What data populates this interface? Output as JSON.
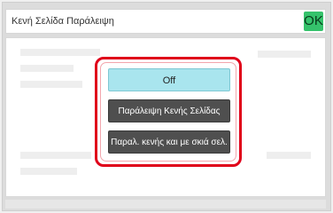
{
  "header": {
    "title": "Κενή Σελίδα Παράλειψη",
    "ok_label": "OK"
  },
  "dialog": {
    "options": [
      {
        "label": "Off",
        "selected": true
      },
      {
        "label": "Παράλειψη Κενής Σελίδας",
        "selected": false
      },
      {
        "label": "Παραλ. κενής και με σκιά σελ.",
        "selected": false
      }
    ]
  },
  "colors": {
    "ok_button": "#35c26b",
    "highlight_border": "#e0001a",
    "selected_option": "#a9e5ee",
    "option_dark": "#4f4f4f"
  },
  "icons": {}
}
